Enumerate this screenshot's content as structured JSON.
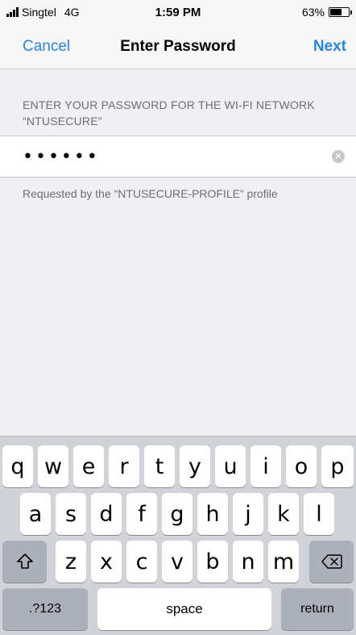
{
  "status_bar": {
    "carrier": "Singtel",
    "network": "4G",
    "time": "1:59 PM",
    "battery": "63%",
    "battery_level": 0.63
  },
  "nav": {
    "cancel_label": "Cancel",
    "title": "Enter Password",
    "next_label": "Next"
  },
  "form": {
    "header": "ENTER YOUR PASSWORD FOR THE WI-FI NETWORK “NTUSECURE”",
    "password_value": "••••••",
    "footer": "Requested by the “NTUSECURE-PROFILE” profile"
  },
  "keyboard": {
    "row1": [
      "q",
      "w",
      "e",
      "r",
      "t",
      "y",
      "u",
      "i",
      "o",
      "p"
    ],
    "row2": [
      "a",
      "s",
      "d",
      "f",
      "g",
      "h",
      "j",
      "k",
      "l"
    ],
    "row3": [
      "z",
      "x",
      "c",
      "v",
      "b",
      "n",
      "m"
    ],
    "numbers_label": ".?123",
    "space_label": "space",
    "return_label": "return",
    "shift_icon": "shift-icon",
    "delete_icon": "delete-icon"
  }
}
